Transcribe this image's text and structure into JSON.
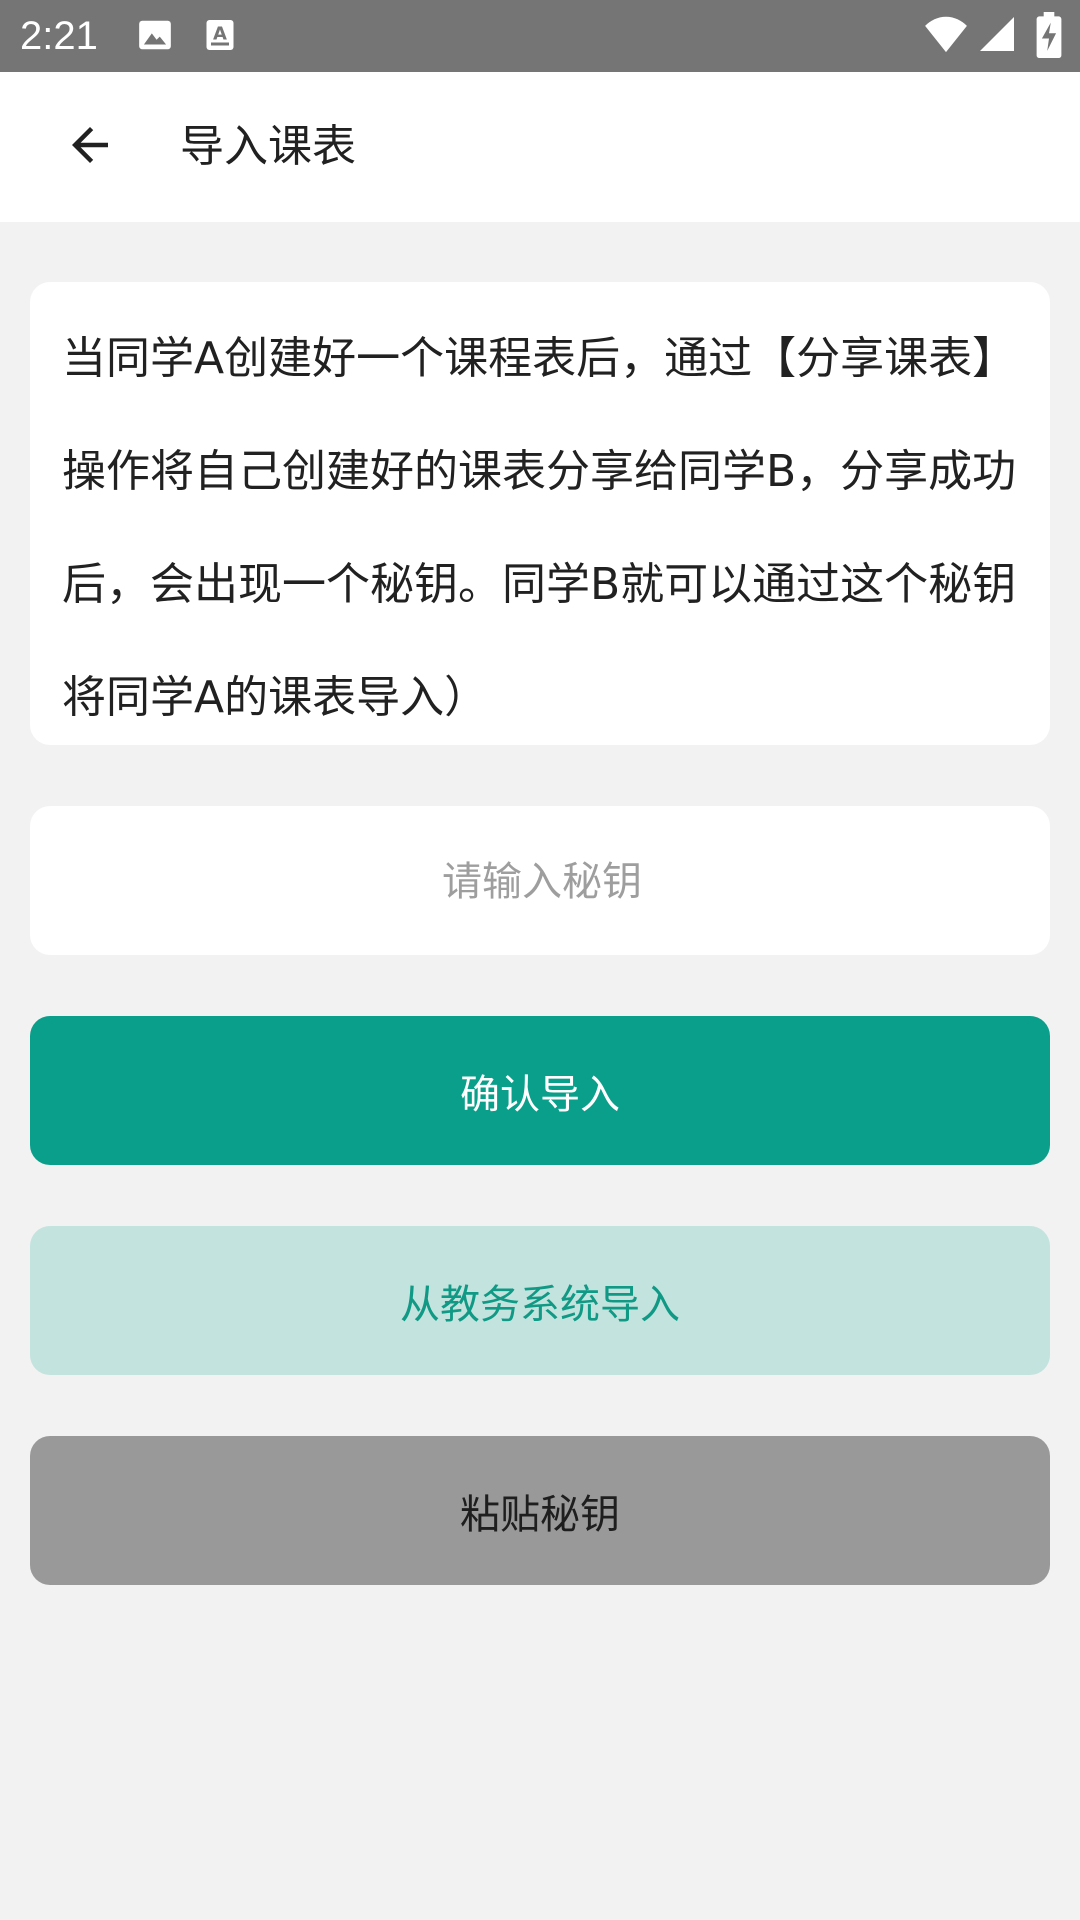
{
  "status_bar": {
    "time": "2:21",
    "icons": [
      "image-icon",
      "font-download-icon",
      "wifi-icon",
      "signal-icon",
      "battery-charging-icon"
    ]
  },
  "app_bar": {
    "back_icon": "arrow-back-icon",
    "title": "导入课表"
  },
  "intro": {
    "text": "当同学A创建好一个课程表后，通过【分享课表】操作将自己创建好的课表分享给同学B，分享成功后，会出现一个秘钥。同学B就可以通过这个秘钥将同学A的课表导入）"
  },
  "key_input": {
    "value": "",
    "placeholder": "请输入秘钥"
  },
  "buttons": {
    "confirm_label": "确认导入",
    "system_label": "从教务系统导入",
    "paste_label": "粘贴秘钥"
  },
  "colors": {
    "primary": "#0a9f8a",
    "primary_light": "#c3e3de",
    "primary_text": "#109985",
    "gray_button": "#999999",
    "status_bar": "#757575",
    "background": "#f2f2f2"
  }
}
